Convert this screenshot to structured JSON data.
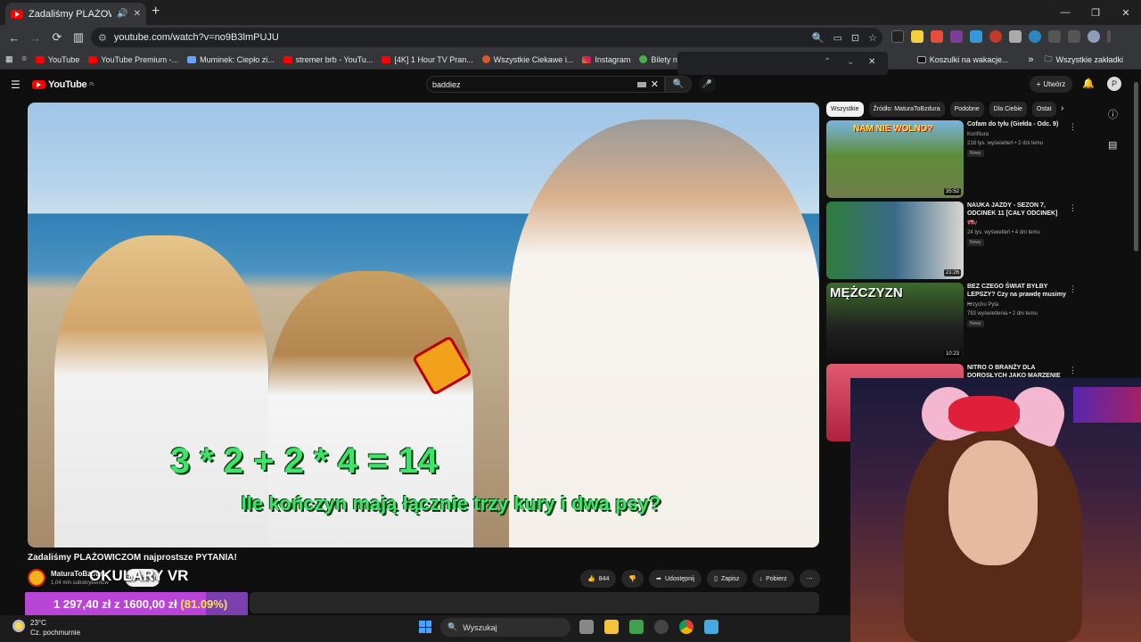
{
  "browser": {
    "tab_title": "Zadaliśmy PLAŻOWICZOM",
    "new_tab": "+",
    "url": "youtube.com/watch?v=no9B3lmPUJU",
    "window_min": "—",
    "window_max": "❐",
    "window_close": "✕",
    "nav_back": "←",
    "nav_forward": "→",
    "nav_reload": "⟳"
  },
  "bookmarks": {
    "items": [
      {
        "label": "YouTube",
        "icon": "youtube-icon"
      },
      {
        "label": "YouTube Premium -...",
        "icon": "youtube-icon"
      },
      {
        "label": "Muminek: Ciepło zi...",
        "icon": "bookmark-icon"
      },
      {
        "label": "stremer brb - YouTu...",
        "icon": "youtube-icon"
      },
      {
        "label": "[4K] 1 Hour TV Pran...",
        "icon": "youtube-icon"
      },
      {
        "label": "Wszystkie Ciekawe i...",
        "icon": "bookmark-icon"
      },
      {
        "label": "Instagram",
        "icon": "instagram-icon"
      },
      {
        "label": "Bilety na I",
        "icon": "bookmark-icon"
      }
    ],
    "right_item": "Koszulki na wakacje...",
    "more": "»",
    "all_bookmarks": "Wszystkie zakładki"
  },
  "findbar": {
    "up": "⌃",
    "down": "⌄",
    "close": "✕"
  },
  "youtube": {
    "logo": "YouTube",
    "logo_region": "PL",
    "search_value": "baddiez",
    "search_clear": "✕",
    "create_label": "Utwórz",
    "avatar_letter": "P"
  },
  "video": {
    "caption_equation": "3 * 2 + 2 * 4 = 14",
    "caption_question": "Ile kończyn mają łącznie trzy kury i dwa psy?",
    "title": "Zadaliśmy PLAŻOWICZOM najprostsze PYTANIA!",
    "channel_name": "MaturaToBzdura",
    "subscribers": "1,04 mln subskrybentów",
    "subscribe_label": "Subskrybuj",
    "overlay_text": "OKULARY VR",
    "like_count": "844",
    "share_label": "Udostępnij",
    "save_label": "Zapisz",
    "download_label": "Pobierz",
    "more": "⋯"
  },
  "donation_goal": {
    "current": "1 297,40 zł",
    "separator": "z",
    "target": "1600,00 zł",
    "percent_text": "(81.09%)",
    "progress": 0.8109
  },
  "sidebar": {
    "chips": [
      "Wszystkie",
      "Źródło: MaturaToBzdura",
      "Podobne",
      "Dla Ciebie",
      "Ostat"
    ],
    "chips_next": "›",
    "recommendations": [
      {
        "title": "Cofam do tyłu (Giełda - Odc. 9)",
        "channel": "Konfitura",
        "meta": "218 tys. wyświetleń • 2 dni temu",
        "badge": "Nowy",
        "duration": "35:52",
        "thumb_text": "NAM NIE WOLNO?"
      },
      {
        "title": "NAUKA JAZDY - SEZON 7, ODCINEK 11 [CAŁY ODCINEK] 🚗",
        "channel": "TTV",
        "meta": "24 tys. wyświetleń • 4 dni temu",
        "badge": "Nowy",
        "duration": "21:26",
        "thumb_text": ""
      },
      {
        "title": "BEZ CZEGO ŚWIAT BYŁBY LEPSZY? Czy na prawdę musimy ...",
        "channel": "Krzychu Pyta",
        "meta": "793 wyświetlenia • 2 dni temu",
        "badge": "Nowy",
        "duration": "10:23",
        "thumb_text": "MĘŻCZYZN"
      },
      {
        "title": "NITRO O BRANŻY DLA DOROSŁYCH JAKO MARZENIE ...",
        "channel": "",
        "meta": "",
        "badge": "",
        "duration": "",
        "thumb_text": ""
      }
    ]
  },
  "taskbar": {
    "temperature": "23°C",
    "weather": "Cz. pochmurnie",
    "search_placeholder": "Wyszukaj"
  }
}
